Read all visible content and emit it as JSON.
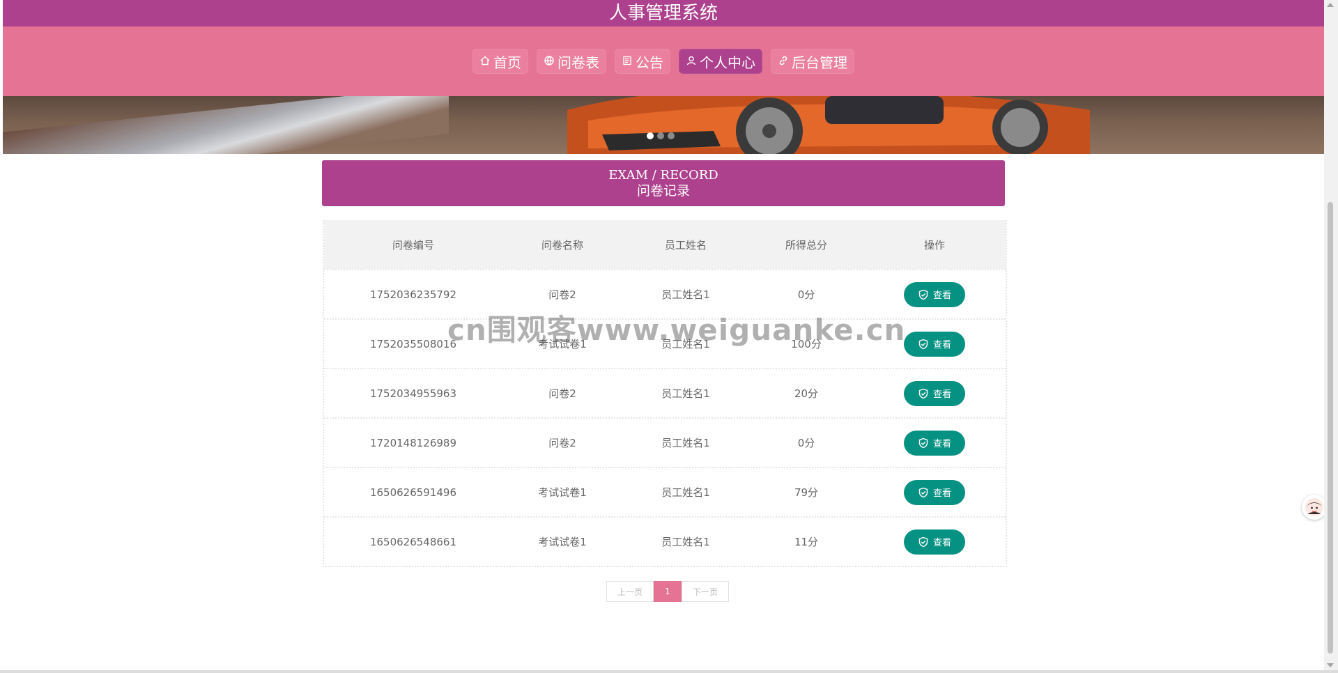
{
  "header": {
    "site_title": "人事管理系统"
  },
  "nav": {
    "items": [
      {
        "label": "首页",
        "icon": "home-icon",
        "active": false
      },
      {
        "label": "问卷表",
        "icon": "globe-icon",
        "active": false
      },
      {
        "label": "公告",
        "icon": "notice-icon",
        "active": false
      },
      {
        "label": "个人中心",
        "icon": "user-icon",
        "active": true
      },
      {
        "label": "后台管理",
        "icon": "link-icon",
        "active": false
      }
    ]
  },
  "banner": {
    "slides": 3,
    "active_slide": 1
  },
  "section": {
    "title_en": "EXAM / RECORD",
    "title_cn": "问卷记录"
  },
  "table": {
    "headers": [
      "问卷编号",
      "问卷名称",
      "员工姓名",
      "所得总分",
      "操作"
    ],
    "rows": [
      {
        "id": "1752036235792",
        "name": "问卷2",
        "employee": "员工姓名1",
        "score": "0分"
      },
      {
        "id": "1752035508016",
        "name": "考试试卷1",
        "employee": "员工姓名1",
        "score": "100分"
      },
      {
        "id": "1752034955963",
        "name": "问卷2",
        "employee": "员工姓名1",
        "score": "20分"
      },
      {
        "id": "1720148126989",
        "name": "问卷2",
        "employee": "员工姓名1",
        "score": "0分"
      },
      {
        "id": "1650626591496",
        "name": "考试试卷1",
        "employee": "员工姓名1",
        "score": "79分"
      },
      {
        "id": "1650626548661",
        "name": "考试试卷1",
        "employee": "员工姓名1",
        "score": "11分"
      }
    ],
    "view_label": "查看"
  },
  "pagination": {
    "prev": "上一页",
    "current": "1",
    "next": "下一页"
  },
  "watermark": "cn围观客www.weiguanke.cn",
  "colors": {
    "primary": "#ad418d",
    "nav_bg": "#e57394",
    "button": "#069283"
  }
}
